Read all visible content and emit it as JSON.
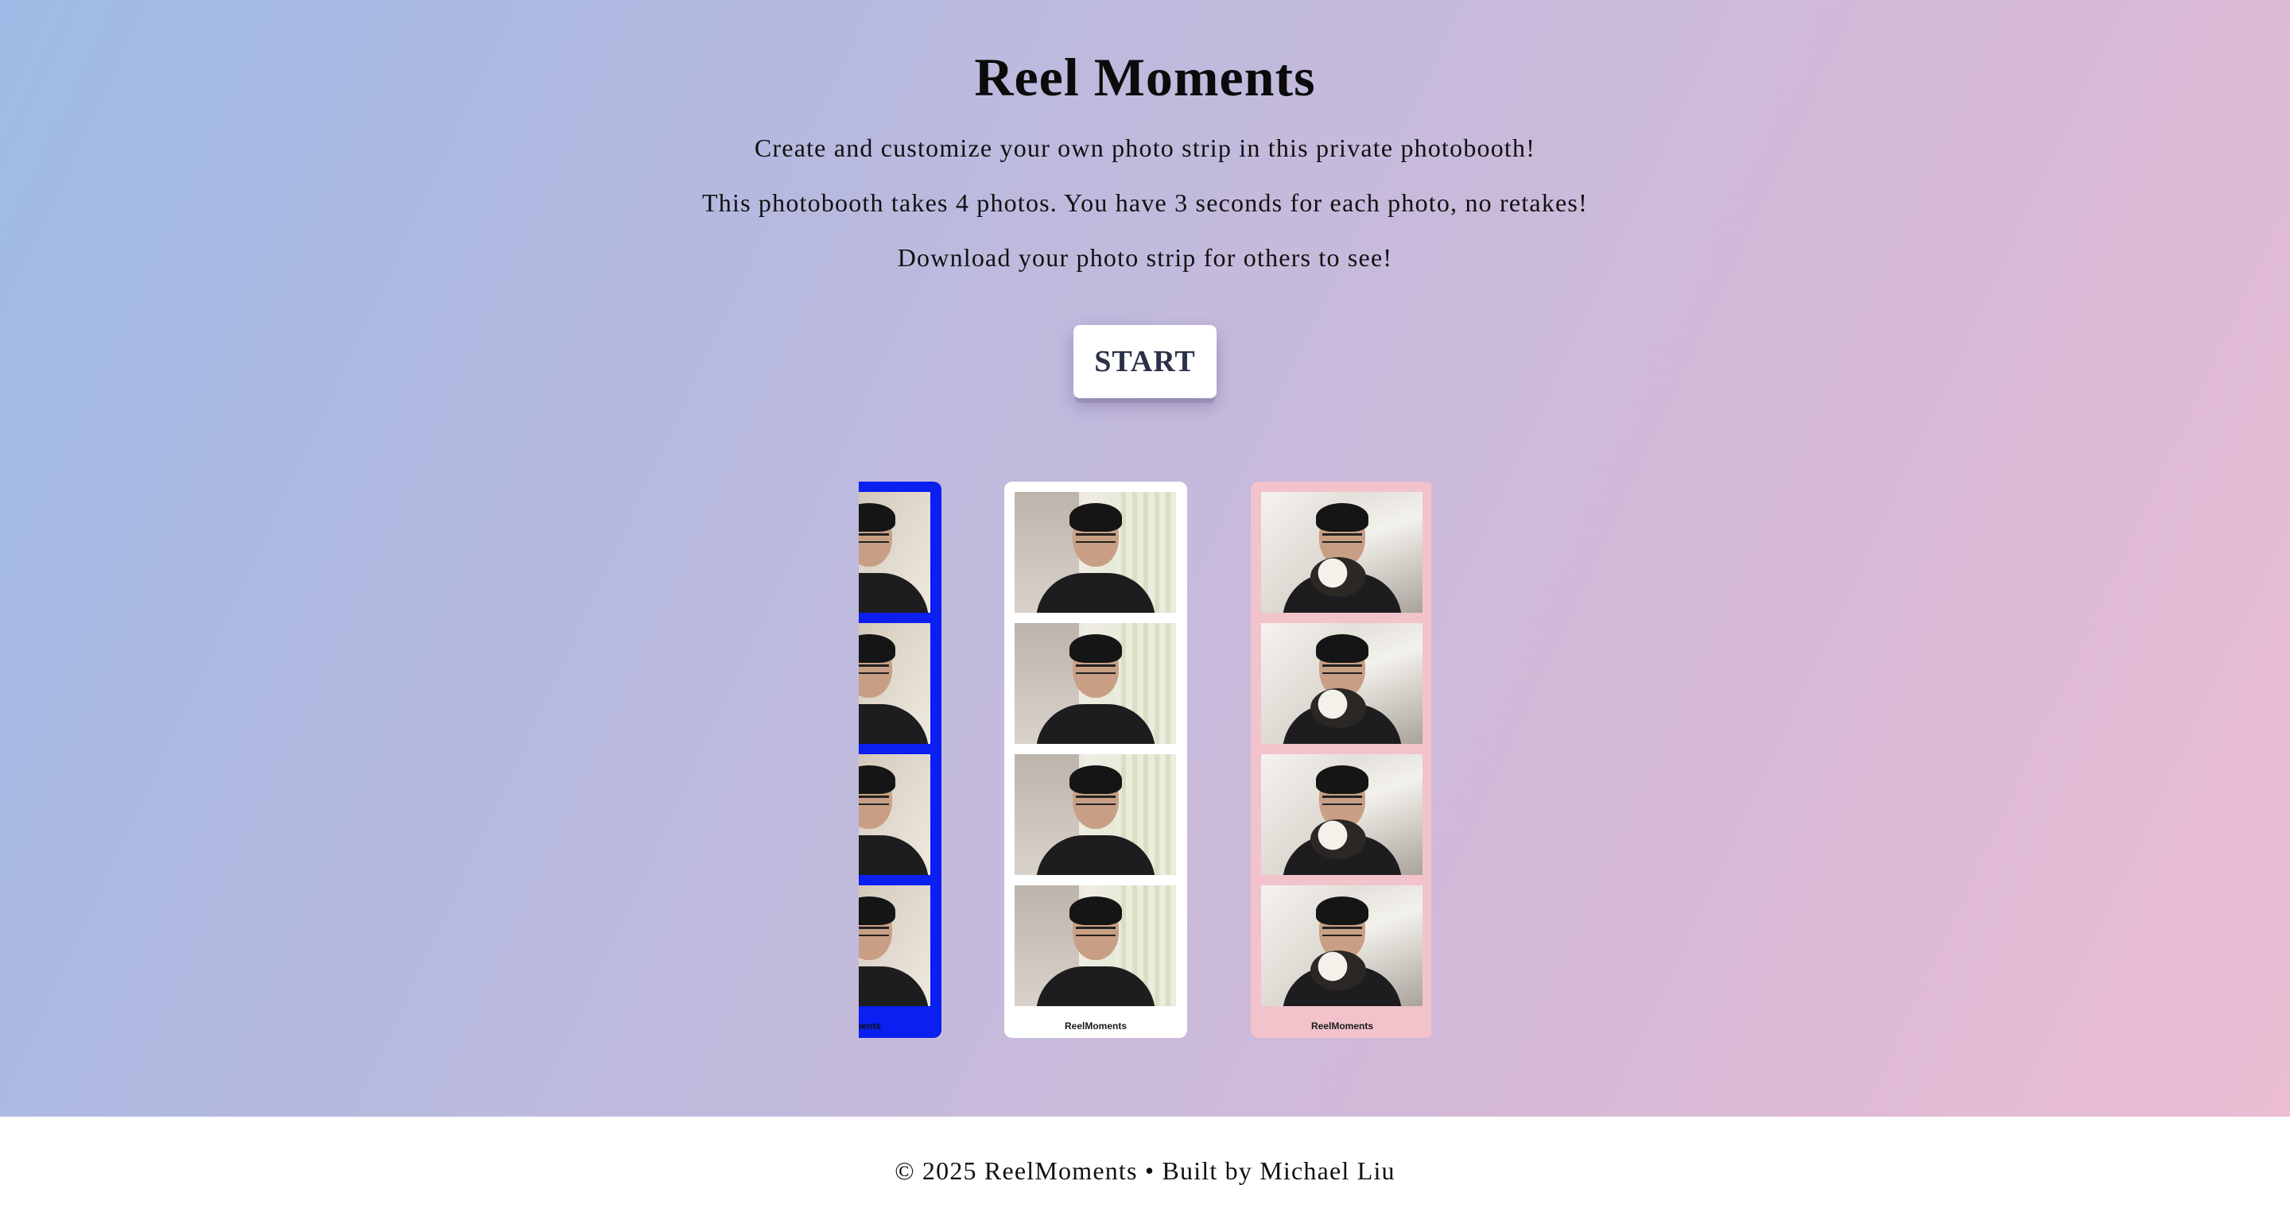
{
  "header": {
    "title": "Reel Moments",
    "lines": [
      "Create and customize your own photo strip in this private photobooth!",
      "This photobooth takes 4 photos. You have 3 seconds for each photo, no retakes!",
      "Download your photo strip for others to see!"
    ]
  },
  "start_button": {
    "label": "START"
  },
  "strips": [
    {
      "color": "#0a1ff0",
      "caption": "ReelMoments"
    },
    {
      "color": "#ffffff",
      "caption": "ReelMoments"
    },
    {
      "color": "#f2c3cb",
      "caption": "ReelMoments"
    }
  ],
  "footer": {
    "text": "© 2025 ReelMoments • Built by Michael Liu"
  },
  "theme": {
    "gradient_start": "#9dbbe6",
    "gradient_end": "#ecbdd3",
    "button_text": "#2a3148"
  }
}
